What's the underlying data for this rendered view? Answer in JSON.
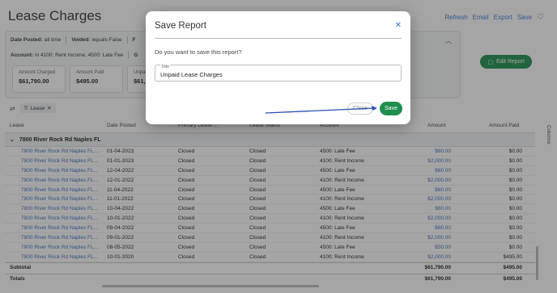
{
  "page": {
    "title": "Lease Charges",
    "actions": [
      "Refresh",
      "Email",
      "Export",
      "Save"
    ]
  },
  "filters": {
    "row1": [
      {
        "key": "Date Posted:",
        "value": "all time"
      },
      {
        "key": "Voided:",
        "value": "equals False"
      },
      {
        "key": "F",
        "value": ""
      }
    ],
    "row2": [
      {
        "key": "Account:",
        "value": "in 4100: Rent Income, 4500: Late Fee"
      },
      {
        "key": "G",
        "value": ""
      }
    ]
  },
  "kpis": [
    {
      "label": "Amount Charged",
      "value": "$61,790.00"
    },
    {
      "label": "Amount Paid",
      "value": "$495.00"
    },
    {
      "label": "Unpai",
      "value": "$61,2"
    }
  ],
  "edit_report_label": "Edit Report",
  "chip_label": "Lease",
  "grid": {
    "headers": [
      "Lease",
      "Date Posted",
      "Primary Lease ...",
      "Lease Status",
      "Account",
      "Amount",
      "Amount Paid"
    ],
    "group": "7800 River Rock Rd Naples FL",
    "rows": [
      [
        "7800 River Rock Rd Naples FL...",
        "01-04-2023",
        "Closed",
        "Closed",
        "4500: Late Fee",
        "$60.00",
        "$0.00"
      ],
      [
        "7800 River Rock Rd Naples FL...",
        "01-01-2023",
        "Closed",
        "Closed",
        "4100: Rent Income",
        "$2,000.00",
        "$0.00"
      ],
      [
        "7800 River Rock Rd Naples FL...",
        "12-04-2022",
        "Closed",
        "Closed",
        "4500: Late Fee",
        "$60.00",
        "$0.00"
      ],
      [
        "7800 River Rock Rd Naples FL...",
        "12-01-2022",
        "Closed",
        "Closed",
        "4100: Rent Income",
        "$2,000.00",
        "$0.00"
      ],
      [
        "7800 River Rock Rd Naples FL...",
        "11-04-2022",
        "Closed",
        "Closed",
        "4500: Late Fee",
        "$60.00",
        "$0.00"
      ],
      [
        "7800 River Rock Rd Naples FL...",
        "11-01-2022",
        "Closed",
        "Closed",
        "4100: Rent Income",
        "$2,000.00",
        "$0.00"
      ],
      [
        "7800 River Rock Rd Naples FL...",
        "10-04-2022",
        "Closed",
        "Closed",
        "4500: Late Fee",
        "$60.00",
        "$0.00"
      ],
      [
        "7800 River Rock Rd Naples FL...",
        "10-01-2022",
        "Closed",
        "Closed",
        "4100: Rent Income",
        "$2,000.00",
        "$0.00"
      ],
      [
        "7800 River Rock Rd Naples FL...",
        "09-04-2022",
        "Closed",
        "Closed",
        "4500: Late Fee",
        "$60.00",
        "$0.00"
      ],
      [
        "7800 River Rock Rd Naples FL...",
        "09-01-2022",
        "Closed",
        "Closed",
        "4100: Rent Income",
        "$2,000.00",
        "$0.00"
      ],
      [
        "7800 River Rock Rd Naples FL...",
        "08-05-2022",
        "Closed",
        "Closed",
        "4500: Late Fee",
        "$50.00",
        "$0.00"
      ],
      [
        "7800 River Rock Rd Naples FL...",
        "10-01-2020",
        "Closed",
        "Closed",
        "4100: Rent Income",
        "$2,000.00",
        "$495.00"
      ]
    ],
    "subtotal": {
      "label": "Subtotal",
      "amount": "$61,790.00",
      "paid": "$495.00"
    },
    "totals": {
      "label": "Totals",
      "amount": "$61,790.00",
      "paid": "$495.00"
    },
    "side_label": "Columns"
  },
  "modal": {
    "title": "Save Report",
    "question": "Do you want to save this report?",
    "field_label": "Title",
    "field_value": "Unpaid Lease Charges",
    "cancel_label": "Close",
    "save_label": "Save",
    "close_icon": "close-icon"
  },
  "colors": {
    "accent": "#1d8f4d",
    "link": "#3a7bd5",
    "annotation_arrow": "#2a4fb5"
  }
}
